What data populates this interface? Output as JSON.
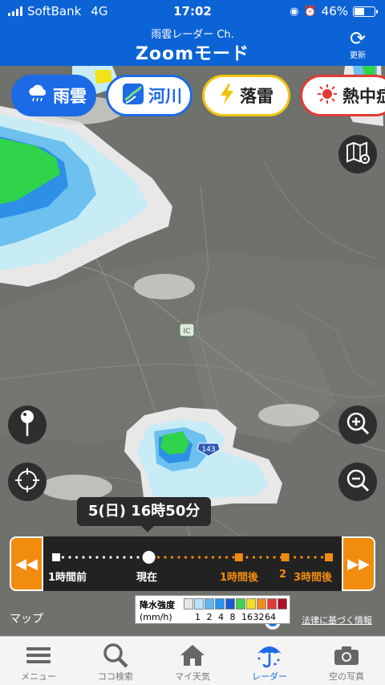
{
  "status_bar": {
    "carrier": "SoftBank",
    "network": "4G",
    "time": "17:02",
    "battery": "46%"
  },
  "header": {
    "subtitle": "雨雲レーダー Ch.",
    "title": "Zoomモード",
    "refresh_label": "更新"
  },
  "layers": [
    {
      "label": "雨雲",
      "icon": "rain-cloud-icon"
    },
    {
      "label": "河川",
      "icon": "river-icon"
    },
    {
      "label": "落雷",
      "icon": "lightning-icon"
    },
    {
      "label": "熱中症",
      "icon": "sun-icon"
    }
  ],
  "map": {
    "road_ic": "IC",
    "route_number": "143"
  },
  "timeline": {
    "current_time": "5(日) 16時50分",
    "rewind_icon": "rewind-icon",
    "forward_icon": "fast-forward-icon",
    "label_1h_before": "1時間前",
    "label_now": "現在",
    "label_1h_after": "1時間後",
    "label_2": "2",
    "label_3h_after": "3時間後",
    "position": 0.34
  },
  "legend": {
    "title": "降水強度",
    "unit": "(mm/h)",
    "ticks": [
      "1",
      "2",
      "4",
      "8",
      "16",
      "32",
      "64"
    ],
    "colors": [
      "#e6e6e6",
      "#b3e5fc",
      "#64b5f6",
      "#2196f3",
      "#1e58d1",
      "#3ed34e",
      "#f3e21b",
      "#f08c1a",
      "#e53935",
      "#b0102a"
    ]
  },
  "attribution": {
    "left": "マップ",
    "right": "法律に基づく情報"
  },
  "tabbar": [
    {
      "label": "メニュー",
      "icon": "menu-icon",
      "active": false
    },
    {
      "label": "ココ検索",
      "icon": "search-icon",
      "active": false
    },
    {
      "label": "マイ天気",
      "icon": "home-icon",
      "active": false
    },
    {
      "label": "レーダー",
      "icon": "umbrella-icon",
      "active": true
    },
    {
      "label": "空の写真",
      "icon": "camera-icon",
      "active": false
    }
  ],
  "colors": {
    "header_blue": "#0b63d6",
    "accent_orange": "#f28c0f",
    "active_tab": "#1c6ae6"
  }
}
